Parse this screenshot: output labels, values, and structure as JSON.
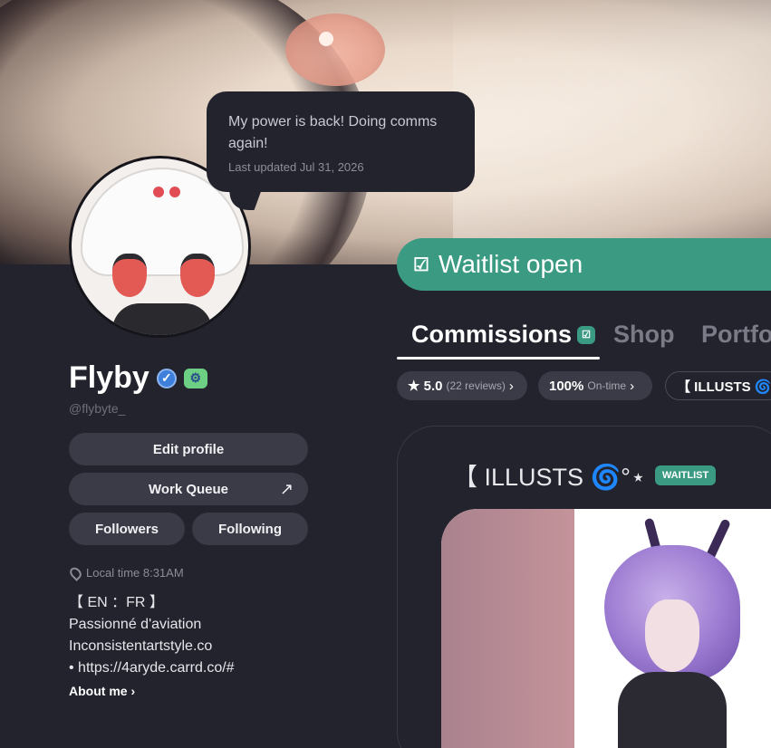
{
  "status": {
    "message": "My power is back! Doing comms again!",
    "updated": "Last updated Jul 31, 2026"
  },
  "profile": {
    "name": "Flyby",
    "handle": "@flybyte_",
    "verified_icon": "✓",
    "sticker_icon": "⚙"
  },
  "buttons": {
    "edit_profile": "Edit profile",
    "work_queue": "Work Queue",
    "work_queue_arrow": "↗",
    "followers": "Followers",
    "following": "Following"
  },
  "info": {
    "local_time": "Local time 8:31AM",
    "bio": [
      "【 EN ：FR 】",
      "Passionné d'aviation",
      "Inconsistentartstyle.co",
      "• https://4aryde.carrd.co/#"
    ],
    "about_me": "About me ›"
  },
  "waitlist": {
    "icon": "☑",
    "label": "Waitlist open"
  },
  "tabs": {
    "commissions": "Commissions",
    "commissions_badge": "☑",
    "shop": "Shop",
    "portfolio": "Portfo"
  },
  "pills": {
    "rating": "★ 5.0",
    "reviews": "(22 reviews)",
    "ontime_value": "100%",
    "ontime_label": "On-time",
    "chevron": "›",
    "illusts": "【 ILLUSTS 🌀°⋆"
  },
  "card": {
    "title": "【 ILLUSTS 🌀°⋆",
    "tag": "WAITLIST"
  },
  "colors": {
    "background": "#22232d",
    "accent": "#3a9a82",
    "button": "#3a3b46",
    "verified": "#3e7fdc"
  }
}
